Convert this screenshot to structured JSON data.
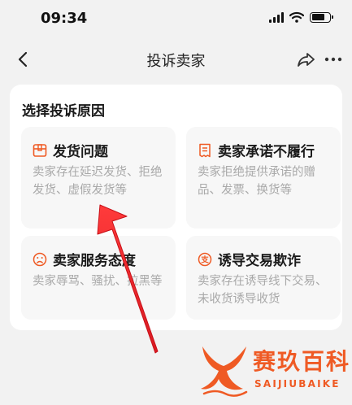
{
  "status_bar": {
    "time": "09:34"
  },
  "nav": {
    "title": "投诉卖家"
  },
  "section": {
    "title": "选择投诉原因"
  },
  "options": [
    {
      "icon": "package-box-icon",
      "title": "发货问题",
      "desc": "卖家存在延迟发货、拒绝发货、虚假发货等"
    },
    {
      "icon": "receipt-list-icon",
      "title": "卖家承诺不履行",
      "desc": "卖家拒绝提供承诺的赠品、发票、换货等"
    },
    {
      "icon": "sad-face-icon",
      "title": "卖家服务态度",
      "desc": "卖家辱骂、骚扰、拉黑等"
    },
    {
      "icon": "inducement-badge-icon",
      "title": "诱导交易欺诈",
      "desc": "卖家存在诱导线下交易、未收货诱导收货"
    }
  ],
  "icon_badge_text": "支",
  "watermark": {
    "title": "赛玖百科",
    "subtitle": "SAIJIUBAIKE"
  },
  "colors": {
    "accent": "#ef5a24",
    "arrow": "#e8242a",
    "background": "#f2f2f2",
    "card": "#ffffff",
    "option_bg": "#f7f7f7",
    "desc_text": "#a9a9a9"
  }
}
